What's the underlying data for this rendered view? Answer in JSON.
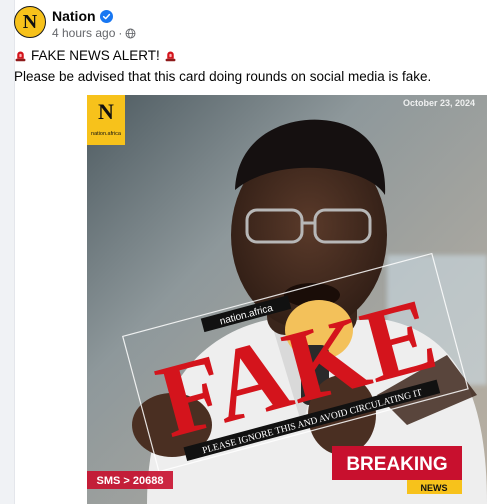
{
  "post": {
    "page_name": "Nation",
    "time_ago": "4 hours ago",
    "separator": "·",
    "alert_text": "FAKE NEWS ALERT!",
    "body_text": "Please be advised that this card doing rounds on social media is fake."
  },
  "card_image": {
    "logo_letter": "N",
    "logo_caption": "nation.africa",
    "date": "October 23, 2024",
    "stamp_site": "nation.africa",
    "stamp_word": "FAKE",
    "stamp_warning": "PLEASE IGNORE THIS AND AVOID CIRCULATING IT",
    "breaking_label": "BREAKING",
    "news_label": "NEWS",
    "sms_text": "SMS > 20688"
  },
  "colors": {
    "verified": "#1877f2",
    "stamp_red": "#d4141c",
    "logo_yellow": "#f7c21b",
    "breaking_red": "#c8102e"
  },
  "icons": {
    "verified": "verified-badge-icon",
    "privacy": "globe-icon",
    "alert": "siren-icon"
  }
}
